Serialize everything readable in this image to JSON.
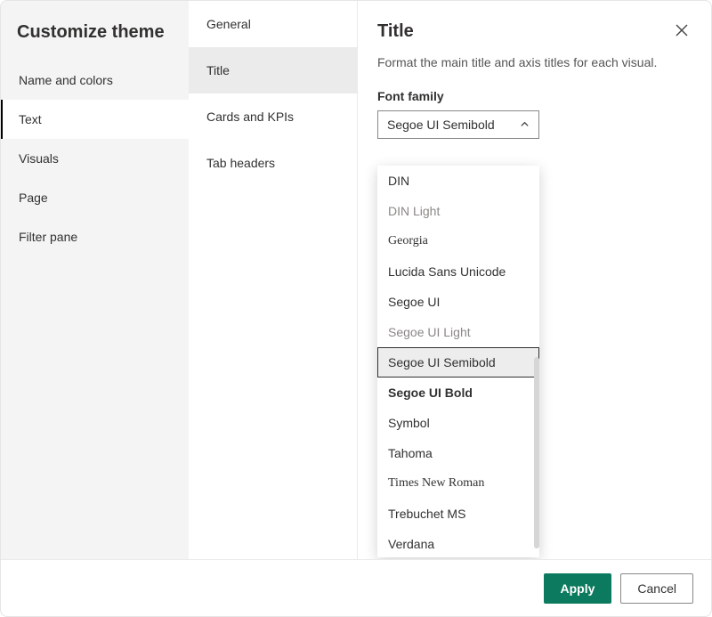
{
  "dialog": {
    "title": "Customize theme"
  },
  "left_nav": {
    "items": [
      {
        "label": "Name and colors",
        "selected": false
      },
      {
        "label": "Text",
        "selected": true
      },
      {
        "label": "Visuals",
        "selected": false
      },
      {
        "label": "Page",
        "selected": false
      },
      {
        "label": "Filter pane",
        "selected": false
      }
    ]
  },
  "mid_nav": {
    "items": [
      {
        "label": "General",
        "selected": false
      },
      {
        "label": "Title",
        "selected": true
      },
      {
        "label": "Cards and KPIs",
        "selected": false
      },
      {
        "label": "Tab headers",
        "selected": false
      }
    ]
  },
  "panel": {
    "heading": "Title",
    "description": "Format the main title and axis titles for each visual.",
    "font_family_label": "Font family",
    "font_family_value": "Segoe UI Semibold"
  },
  "font_options": [
    {
      "label": "DIN",
      "css": "font-family:'DIN',Arial,sans-serif;"
    },
    {
      "label": "DIN Light",
      "css": "font-family:'DIN',Arial,sans-serif; font-weight:300; color:#8a8886;"
    },
    {
      "label": "Georgia",
      "css": "font-family:Georgia,serif;"
    },
    {
      "label": "Lucida Sans Unicode",
      "css": "font-family:'Lucida Sans Unicode','Lucida Grande',sans-serif;"
    },
    {
      "label": "Segoe UI",
      "css": "font-family:'Segoe UI',Arial,sans-serif;"
    },
    {
      "label": "Segoe UI Light",
      "css": "font-family:'Segoe UI',Arial,sans-serif; font-weight:300; color:#8a8886;"
    },
    {
      "label": "Segoe UI Semibold",
      "css": "font-family:'Segoe UI',Arial,sans-serif; font-weight:400;",
      "selected": true
    },
    {
      "label": "Segoe UI Bold",
      "css": "font-family:'Segoe UI',Arial,sans-serif; font-weight:700;"
    },
    {
      "label": "Symbol",
      "css": "font-family:'Segoe UI',Arial,sans-serif;"
    },
    {
      "label": "Tahoma",
      "css": "font-family:Tahoma,Geneva,sans-serif;"
    },
    {
      "label": "Times New Roman",
      "css": "font-family:'Times New Roman',Times,serif;"
    },
    {
      "label": "Trebuchet MS",
      "css": "font-family:'Trebuchet MS',Helvetica,sans-serif;"
    },
    {
      "label": "Verdana",
      "css": "font-family:Verdana,Geneva,sans-serif;"
    }
  ],
  "footer": {
    "apply": "Apply",
    "cancel": "Cancel"
  }
}
